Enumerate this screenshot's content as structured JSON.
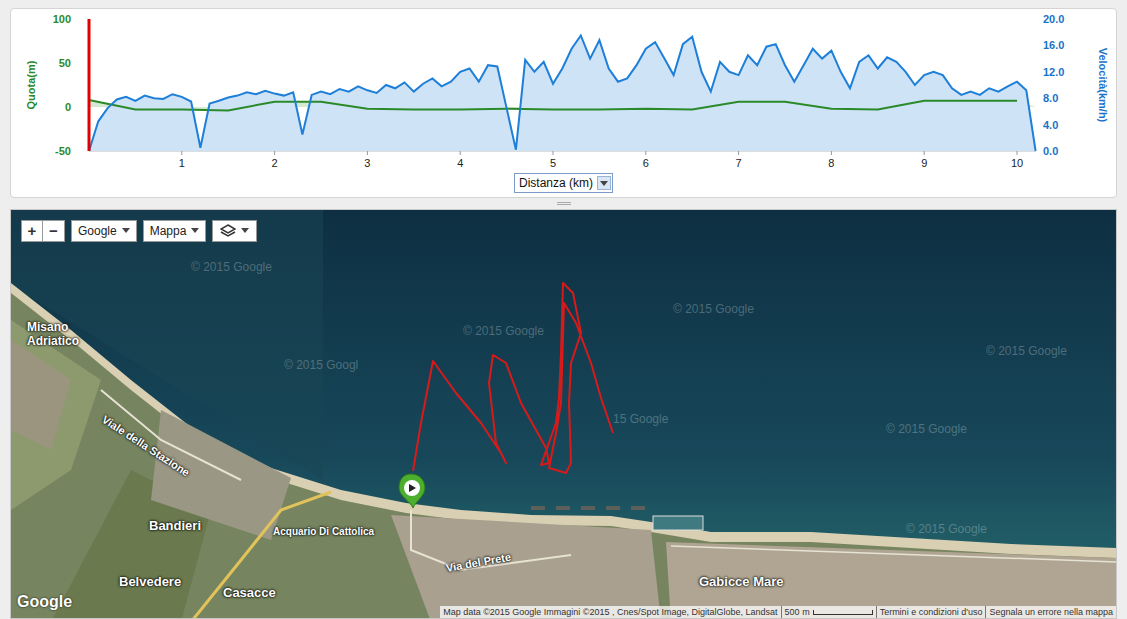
{
  "chart": {
    "left_axis": {
      "title": "Quota(m)",
      "ticks": [
        "100",
        "50",
        "0",
        "-50"
      ]
    },
    "right_axis": {
      "title": "Velocità(km/h)",
      "ticks": [
        "20.0",
        "16.0",
        "12.0",
        "8.0",
        "4.0",
        "0.0"
      ]
    },
    "x_axis": {
      "ticks": [
        "1",
        "2",
        "3",
        "4",
        "5",
        "6",
        "7",
        "8",
        "9",
        "10"
      ],
      "selector": "Distanza (km)"
    },
    "cursor_km": 0,
    "series": [
      {
        "name": "Velocità",
        "axis": "right",
        "step_km": 0.1,
        "color": "#1e7fd8",
        "values": [
          0,
          4.5,
          6.5,
          7.8,
          8.2,
          7.6,
          8.4,
          8.0,
          7.9,
          8.6,
          8.2,
          7.5,
          0.5,
          7.2,
          7.6,
          8.1,
          8.4,
          8.9,
          8.6,
          9.1,
          8.7,
          8.4,
          8.9,
          2.5,
          8.5,
          9.0,
          8.6,
          9.4,
          9.0,
          9.8,
          9.2,
          8.8,
          10.0,
          9.5,
          10.4,
          9.0,
          10.2,
          11.0,
          9.8,
          10.5,
          12.0,
          12.5,
          10.5,
          13.0,
          12.8,
          6.5,
          0.2,
          13.8,
          12.0,
          13.5,
          10.2,
          12.5,
          15.5,
          17.5,
          14.0,
          16.8,
          12.5,
          10.5,
          11.0,
          13.0,
          15.5,
          16.5,
          14.0,
          11.5,
          16.2,
          17.3,
          12.0,
          9.0,
          13.5,
          12.0,
          11.5,
          14.5,
          13.0,
          15.8,
          16.2,
          13.0,
          10.5,
          13.0,
          15.5,
          14.0,
          15.2,
          12.0,
          9.5,
          13.5,
          14.5,
          12.5,
          14.2,
          13.5,
          12.0,
          10.0,
          11.5,
          12.0,
          11.5,
          9.5,
          8.5,
          9.0,
          8.5,
          9.5,
          9.0,
          9.8,
          10.5,
          9.2,
          0.0
        ]
      },
      {
        "name": "Quota",
        "axis": "left",
        "step_km": 0.5,
        "color": "#2a8a2a",
        "values": [
          8,
          -3,
          -3,
          -4,
          6,
          6,
          -2,
          -3,
          -3,
          -2,
          -3,
          -3,
          -2,
          -3,
          6,
          6,
          -2,
          -3,
          7,
          7,
          7
        ]
      }
    ]
  },
  "map": {
    "controls": {
      "zoom_in": "+",
      "zoom_out": "−",
      "provider": "Google",
      "type": "Mappa"
    },
    "labels": [
      {
        "text": "Misano Adriatico"
      },
      {
        "text": "Viale della Stazione"
      },
      {
        "text": "Bandieri"
      },
      {
        "text": "Acquario Di Cattolica"
      },
      {
        "text": "Belvedere"
      },
      {
        "text": "Casacce"
      },
      {
        "text": "Via del Prete"
      },
      {
        "text": "Gabicce Mare"
      }
    ],
    "watermarks": [
      "© 2015 Google",
      "© 2015 Google",
      "© 2015 Googl",
      "© 2015 Google",
      "15 Google",
      "© 2015 Google",
      "© 2015 Google",
      "© 2015 Google"
    ],
    "logo": "Google",
    "attribution": "Map data ©2015 Google Immagini ©2015 , Cnes/Spot Image, DigitalGlobe, Landsat",
    "scale": "500 m",
    "links": [
      "Termini e condizioni d'uso",
      "Segnala un errore nella mappa"
    ]
  }
}
